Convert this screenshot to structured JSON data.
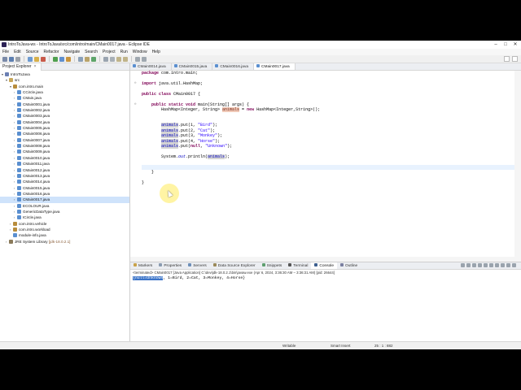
{
  "window": {
    "title": "IntroToJava-ws - IntroToJava/src/com/intro/main/CMain0017.java - Eclipse IDE"
  },
  "menu": [
    "File",
    "Edit",
    "Source",
    "Refactor",
    "Navigate",
    "Search",
    "Project",
    "Run",
    "Window",
    "Help"
  ],
  "explorer": {
    "tab_label": "Project Explorer",
    "rows": [
      {
        "label": "IntroToJava",
        "indent": 1,
        "arrow": "▾",
        "icon": "#6b7fb3"
      },
      {
        "label": "src",
        "indent": 2,
        "arrow": "▾",
        "icon": "#c8a75a"
      },
      {
        "label": "com.intro.main",
        "indent": 3,
        "arrow": "▾",
        "icon": "#b88d3c"
      },
      {
        "label": "CCircle.java",
        "indent": 4,
        "arrow": "›",
        "icon": "#5a8fd0"
      },
      {
        "label": "CMain.java",
        "indent": 4,
        "arrow": "›",
        "icon": "#5a8fd0"
      },
      {
        "label": "CMain0001.java",
        "indent": 4,
        "arrow": "›",
        "icon": "#5a8fd0"
      },
      {
        "label": "CMain0002.java",
        "indent": 4,
        "arrow": "›",
        "icon": "#5a8fd0"
      },
      {
        "label": "CMain0003.java",
        "indent": 4,
        "arrow": "›",
        "icon": "#5a8fd0"
      },
      {
        "label": "CMain0004.java",
        "indent": 4,
        "arrow": "›",
        "icon": "#5a8fd0"
      },
      {
        "label": "CMain0005.java",
        "indent": 4,
        "arrow": "›",
        "icon": "#5a8fd0"
      },
      {
        "label": "CMain0006.java",
        "indent": 4,
        "arrow": "›",
        "icon": "#5a8fd0"
      },
      {
        "label": "CMain0007.java",
        "indent": 4,
        "arrow": "›",
        "icon": "#5a8fd0"
      },
      {
        "label": "CMain0008.java",
        "indent": 4,
        "arrow": "›",
        "icon": "#5a8fd0"
      },
      {
        "label": "CMain0009.java",
        "indent": 4,
        "arrow": "›",
        "icon": "#5a8fd0"
      },
      {
        "label": "CMain0010.java",
        "indent": 4,
        "arrow": "›",
        "icon": "#5a8fd0"
      },
      {
        "label": "CMain0011.java",
        "indent": 4,
        "arrow": "›",
        "icon": "#5a8fd0"
      },
      {
        "label": "CMain0012.java",
        "indent": 4,
        "arrow": "›",
        "icon": "#5a8fd0"
      },
      {
        "label": "CMain0013.java",
        "indent": 4,
        "arrow": "›",
        "icon": "#5a8fd0"
      },
      {
        "label": "CMain0014.java",
        "indent": 4,
        "arrow": "›",
        "icon": "#5a8fd0"
      },
      {
        "label": "CMain0015.java",
        "indent": 4,
        "arrow": "›",
        "icon": "#5a8fd0"
      },
      {
        "label": "CMain0016.java",
        "indent": 4,
        "arrow": "›",
        "icon": "#5a8fd0"
      },
      {
        "label": "CMain0017.java",
        "indent": 4,
        "arrow": "›",
        "icon": "#5a8fd0",
        "selected": true
      },
      {
        "label": "ECOLOUR.java",
        "indent": 4,
        "arrow": "›",
        "icon": "#5a8fd0"
      },
      {
        "label": "GenericDataType.java",
        "indent": 4,
        "arrow": "›",
        "icon": "#5a8fd0"
      },
      {
        "label": "ICircle.java",
        "indent": 4,
        "arrow": "›",
        "icon": "#5a8fd0"
      },
      {
        "label": "com.intro.vehicle",
        "indent": 3,
        "arrow": "›",
        "icon": "#b88d3c"
      },
      {
        "label": "com.intro.workload",
        "indent": 3,
        "arrow": "›",
        "icon": "#b88d3c"
      },
      {
        "label": "module-info.java",
        "indent": 3,
        "arrow": "",
        "icon": "#5a8fd0"
      },
      {
        "label": "JRE System Library",
        "suffix": "[jdk-18.0.2.1]",
        "indent": 2,
        "arrow": "›",
        "icon": "#8a7a5a"
      }
    ]
  },
  "editor": {
    "tabs": [
      "CMain0014.java",
      "CMain0015.java",
      "CMain0016.java",
      "CMain0017.java"
    ],
    "active_tab": 3
  },
  "bottom_panel": {
    "tabs": [
      "Markers",
      "Properties",
      "Servers",
      "Data Source Explorer",
      "Snippets",
      "Terminal",
      "Console",
      "Outline"
    ],
    "active_tab": 6,
    "console_status": "<terminated> CMain0017 [Java Application] C:\\dev\\jdk-18.0.2.1\\bin\\javaw.exe (Apr 6, 2024, 3:36:30 AM – 3:36:31 AM) [pid: 26644]",
    "output_selected": "{null=Unknown",
    "output_rest": ", 1=Bird, 2=Cat, 3=Monkey, 4=Horse}"
  },
  "status": {
    "writable": "Writable",
    "insert_mode": "Smart Insert",
    "position": "25 : 1 : 882"
  }
}
